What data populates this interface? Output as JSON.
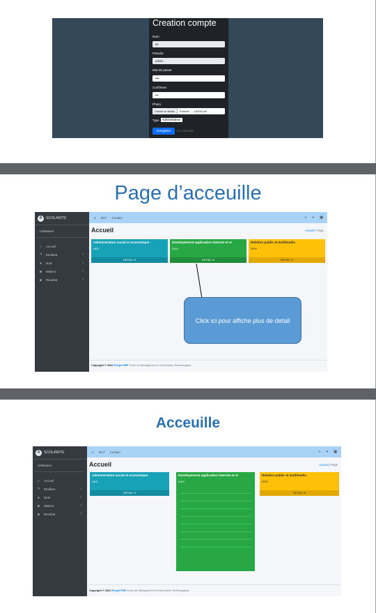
{
  "creation": {
    "title": "Creation compte",
    "fields": [
      {
        "label": "Nom",
        "value": "as"
      },
      {
        "label": "Pseudo",
        "value": "admin"
      },
      {
        "label": "Mot de passe",
        "value": "••••"
      },
      {
        "label": "Confirmer",
        "value": "•••"
      }
    ],
    "photo_label": "Photo",
    "file_button": "Choisir un fichier",
    "file_name": "Enanvie - ...L8Z5S.pdf",
    "type_label": "Type",
    "type_value": "Administrateur",
    "submit": "Enregistrer",
    "login_link": "Se connecter"
  },
  "heading_page": "Page d’acceuille",
  "heading_acceuille": "Acceuille",
  "dashboard": {
    "brand": "SCOLARITE",
    "logo_letter": "A",
    "user": "Utilisateur",
    "menu": [
      {
        "label": "Accueil",
        "icon": "home-icon",
        "glyph": "⌂",
        "arrow": false
      },
      {
        "label": "Etudiant",
        "icon": "edit-icon",
        "glyph": "✎",
        "arrow": true
      },
      {
        "label": "Note",
        "icon": "clipboard-icon",
        "glyph": "●",
        "arrow": true
      },
      {
        "label": "Matiere",
        "icon": "book-icon",
        "glyph": "■",
        "arrow": true
      },
      {
        "label": "Resultat",
        "icon": "chart-icon",
        "glyph": "■",
        "arrow": true
      }
    ],
    "menu_arrow": "‹",
    "toggle_glyph": "≡",
    "nav_links": [
      "EloT",
      "Contact"
    ],
    "top_icons": [
      {
        "name": "search-icon",
        "glyph": "⌕"
      },
      {
        "name": "expand-icon",
        "glyph": "⌖"
      },
      {
        "name": "grid-icon",
        "glyph": "▦"
      }
    ],
    "page_title": "Accueil",
    "breadcrumb_home": "Accueil",
    "breadcrumb_sep": "/",
    "breadcrumb_current": "Page",
    "cards": [
      {
        "title": "Administration social et economique",
        "code": "AES",
        "detail": "DETAIL ➔",
        "color": "#17a2b8"
      },
      {
        "title": "Developement application internet et st",
        "code": "DAJI",
        "detail": "DETAIL ➔",
        "color": "#28a745"
      },
      {
        "title": "Relation public et multimedia",
        "code": "RPM",
        "detail": "DETAIL ➔",
        "color": "#ffc107"
      }
    ],
    "copyright_prefix": "Copyright © 2022",
    "copyright_brand": "iProjet PHP.",
    "copyright_rest": "Ecole de Management et d'Innovation Technologique"
  },
  "callout": "Click ici pour affiche plus de detail"
}
